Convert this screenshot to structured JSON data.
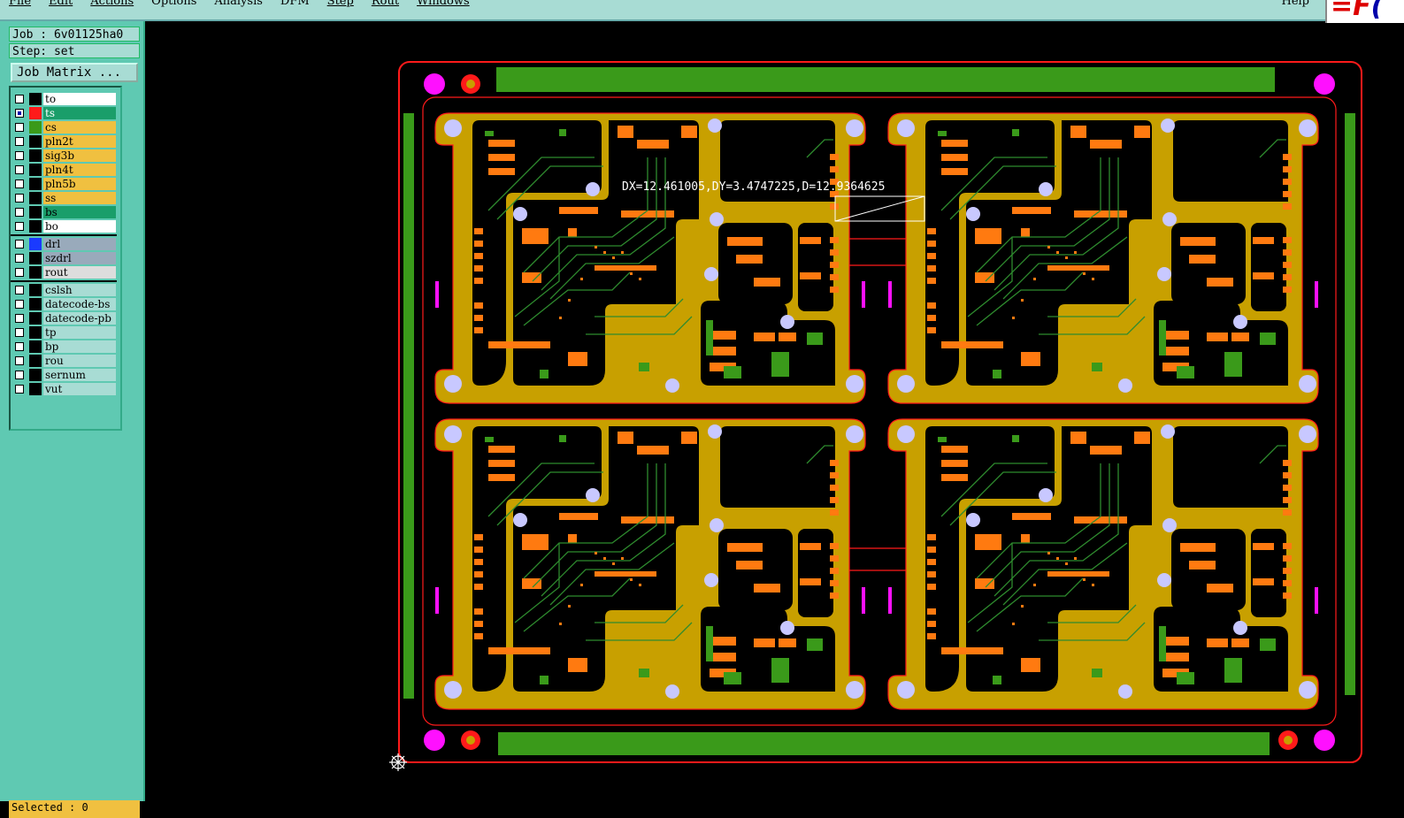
{
  "menu": {
    "items": [
      "File",
      "Edit",
      "Actions",
      "Options",
      "Analysis",
      "DFM",
      "Step",
      "Rout",
      "Windows"
    ],
    "help": "Help"
  },
  "job": {
    "job_line": "Job : 6v01125ha0",
    "step_line": "Step: set",
    "matrix_button": "Job Matrix ..."
  },
  "layers": {
    "group1": [
      {
        "name": "to",
        "color": "#ffffff"
      },
      {
        "name": "ts",
        "color": "#1a9e6a",
        "active": true
      },
      {
        "name": "cs",
        "color": "#f0c040"
      },
      {
        "name": "pln2t",
        "color": "#f0c040"
      },
      {
        "name": "sig3b",
        "color": "#f0c040"
      },
      {
        "name": "pln4t",
        "color": "#f0c040"
      },
      {
        "name": "pln5b",
        "color": "#f0c040"
      },
      {
        "name": "ss",
        "color": "#f0c040"
      },
      {
        "name": "bs",
        "color": "#1a9e6a"
      },
      {
        "name": "bo",
        "color": "#ffffff"
      }
    ],
    "group2": [
      {
        "name": "drl",
        "color": "#9ab"
      },
      {
        "name": "szdrl",
        "color": "#9ab"
      },
      {
        "name": "rout",
        "color": "#ddd"
      }
    ],
    "group3": [
      {
        "name": "cslsh"
      },
      {
        "name": "datecode-bs"
      },
      {
        "name": "datecode-pb"
      },
      {
        "name": "tp"
      },
      {
        "name": "bp"
      },
      {
        "name": "rou"
      },
      {
        "name": "sernum"
      },
      {
        "name": "vut"
      }
    ]
  },
  "status": {
    "selected": "Selected : 0"
  },
  "measurement": {
    "text": "DX=12.461005,DY=3.4747225,D=12.9364625"
  },
  "colors": {
    "board_outline": "#ff1a1a",
    "copper": "#c8a000",
    "solder_green": "#3a9a1a",
    "pad_orange": "#ff7a10",
    "trace_green": "#2e8b2e",
    "hole": "#c8c8ff",
    "fiducial": "#ff10ff"
  },
  "icons": {
    "origin": "origin-crosshair-icon"
  }
}
